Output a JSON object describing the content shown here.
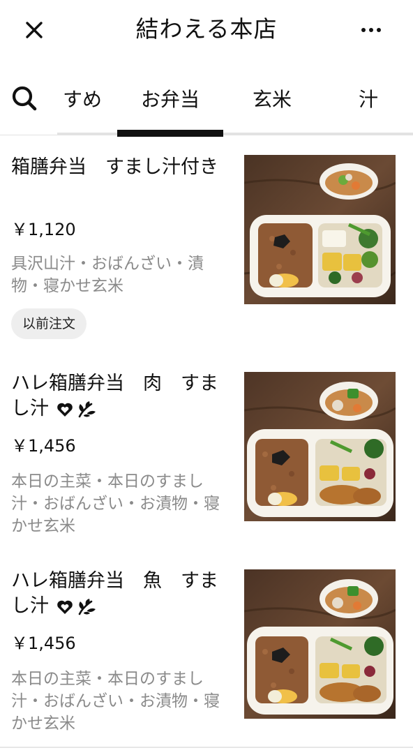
{
  "header": {
    "title": "結わえる本店",
    "close_icon": "close-icon",
    "more_icon": "more-horizontal-icon"
  },
  "tabs": {
    "search_icon": "search-icon",
    "items": [
      {
        "label": "すめ",
        "active": false
      },
      {
        "label": "お弁当",
        "active": true
      },
      {
        "label": "玄米",
        "active": false
      },
      {
        "label": "汁",
        "active": false
      }
    ]
  },
  "menu_items": [
    {
      "title": "箱膳弁当　すまし汁付き",
      "price": "￥1,120",
      "description": "具沢山汁・おばんざい・漬物・寝かせ玄米",
      "badge": "以前注文",
      "icons": []
    },
    {
      "title": "ハレ箱膳弁当　肉　すまし汁",
      "price": "￥1,456",
      "description": "本日の主菜・本日のすまし汁・おばんざい・お漬物・寝かせ玄米",
      "icons": [
        "heart-icon",
        "leaf-icon"
      ]
    },
    {
      "title": "ハレ箱膳弁当　魚　すまし汁",
      "price": "￥1,456",
      "description": "本日の主菜・本日のすまし汁・おばんざい・お漬物・寝かせ玄米",
      "icons": [
        "heart-icon",
        "leaf-icon"
      ]
    }
  ],
  "colors": {
    "text": "#111111",
    "muted": "#8a8a8a",
    "divider": "#e2e2e2",
    "badge_bg": "#eeeeee"
  }
}
